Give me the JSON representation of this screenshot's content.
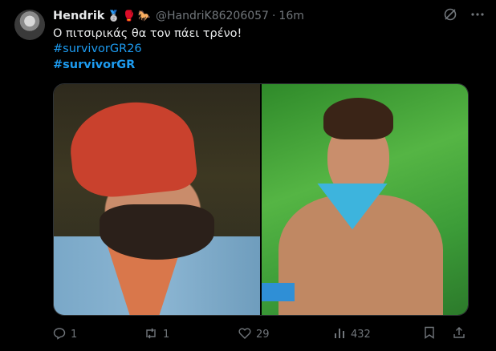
{
  "tweet": {
    "author_name": "Hendrik",
    "author_emojis": [
      "🥈",
      "🥊",
      "🐎"
    ],
    "handle": "@HandriK86206057",
    "separator": "·",
    "time": "16m",
    "text_line1": "Ο πιτσιρικάς θα τον πάει τρένο!",
    "hashtag1": "#survivorGR26",
    "hashtag2": "#survivorGR",
    "stats": {
      "replies": "1",
      "retweets": "1",
      "likes": "29",
      "views": "432"
    }
  },
  "icons": {
    "grok": "grok-icon",
    "more": "more-icon",
    "reply": "reply-icon",
    "retweet": "retweet-icon",
    "like": "heart-icon",
    "views": "views-icon",
    "bookmark": "bookmark-icon",
    "share": "share-icon"
  }
}
